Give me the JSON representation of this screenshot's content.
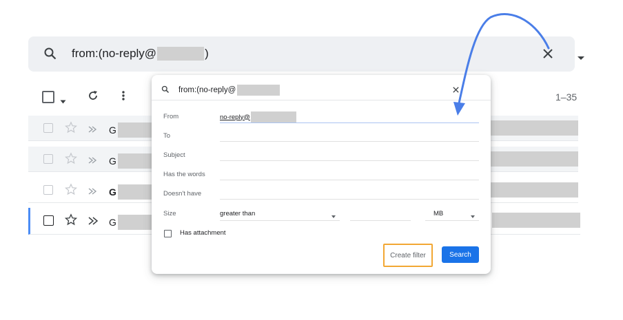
{
  "search": {
    "query_prefix": "from:(no-reply@",
    "query_suffix": ")"
  },
  "toolbar": {
    "count": "1–35"
  },
  "rows": [
    {
      "sender_initial": "G"
    },
    {
      "sender_initial": "G"
    },
    {
      "sender_initial": "G"
    },
    {
      "sender_initial": "G"
    }
  ],
  "popup": {
    "query": "from:(no-reply@",
    "fields": {
      "from_label": "From",
      "from_value": "no-reply@",
      "to_label": "To",
      "subject_label": "Subject",
      "has_words_label": "Has the words",
      "doesnt_have_label": "Doesn't have",
      "size_label": "Size",
      "size_comparator": "greater than",
      "size_unit": "MB",
      "has_attachment_label": "Has attachment"
    },
    "create_filter_label": "Create filter",
    "search_label": "Search"
  },
  "colors": {
    "accent_blue": "#1a73e8",
    "highlight_orange": "#f2a733",
    "arrow_blue": "#4a7ee8"
  }
}
